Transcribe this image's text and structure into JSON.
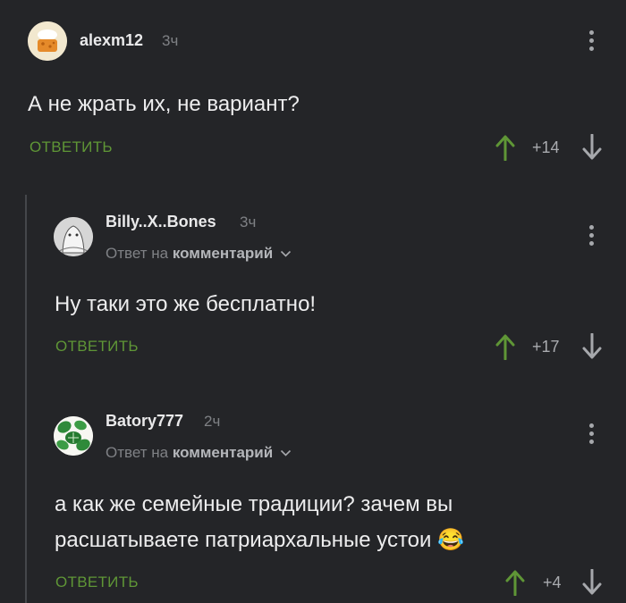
{
  "comments": [
    {
      "username": "alexm12",
      "time": "3ч",
      "text": "А не жрать их, не вариант?",
      "reply_label": "ОТВЕТИТЬ",
      "rating": "+14",
      "avatar_icon": "cheese-avatar-icon"
    },
    {
      "username": "Billy..X..Bones",
      "time": "3ч",
      "reply_to_prefix": "Ответ на",
      "reply_to_target": "комментарий",
      "text": "Ну таки это же бесплатно!",
      "reply_label": "ОТВЕТИТЬ",
      "rating": "+17",
      "avatar_icon": "ghost-figure-avatar-icon"
    },
    {
      "username": "Batory777",
      "time": "2ч",
      "reply_to_prefix": "Ответ на",
      "reply_to_target": "комментарий",
      "text_line1": "а как же семейные традиции? зачем вы",
      "text_line2": "расшатываете патриархальные устои",
      "emoji": "😂",
      "reply_label": "ОТВЕТИТЬ",
      "rating": "+4",
      "avatar_icon": "monstera-leaves-avatar-icon"
    }
  ],
  "colors": {
    "background": "#242528",
    "accent_green": "#5f9636",
    "muted_text": "#7f8185"
  }
}
